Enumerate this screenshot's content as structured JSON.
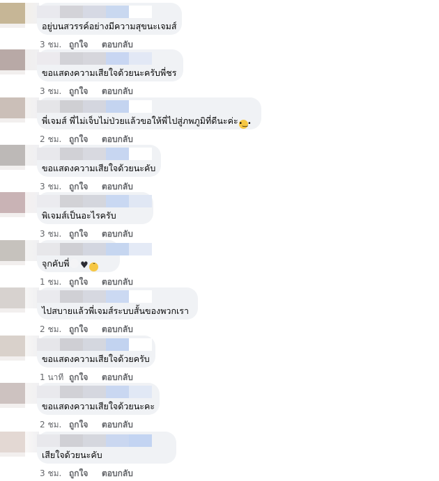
{
  "labels": {
    "like": "ถูกใจ",
    "reply": "ตอบกลับ"
  },
  "comments": [
    {
      "text": "อยู่บนสวรรค์อย่างมีความสุขนะเจมส์",
      "time": "3 ชม.",
      "emoji": []
    },
    {
      "text": "ขอแสดงความเสียใจด้วยนะครับพี่ชร",
      "time": "3 ชม.",
      "emoji": []
    },
    {
      "text": "พี่เจมส์ พี่ไม่เจ็บไม่ป่วยแล้วขอให้พี่ไปสู่ภพภูมิที่ดีนะค่ะ",
      "time": "2 ชม.",
      "emoji": [
        "pleading-face-icon"
      ]
    },
    {
      "text": "ขอแสดงความเสียใจด้วยนะคับ",
      "time": "3 ชม.",
      "emoji": []
    },
    {
      "text": "พิเจมส์เป็นอะไรครับ",
      "time": "3 ชม.",
      "emoji": []
    },
    {
      "text": "จุกคับพี่",
      "time": "1 ชม.",
      "emoji": [
        "white-heart-icon",
        "black-heart-icon",
        "crying-face-icon"
      ]
    },
    {
      "text": "ไปสบายแล้วพี่เจมส์ระบบสั้นของพวกเรา",
      "time": "2 ชม.",
      "emoji": []
    },
    {
      "text": "ขอแสดงความเสียใจด้วยครับ",
      "time": "1 นาที",
      "emoji": []
    },
    {
      "text": "ขอแสดงความเสียใจด้วยนะคะ",
      "time": "2 ชม.",
      "emoji": []
    },
    {
      "text": "เสียใจด้วยนะคับ",
      "time": "3 ชม.",
      "emoji": []
    }
  ]
}
